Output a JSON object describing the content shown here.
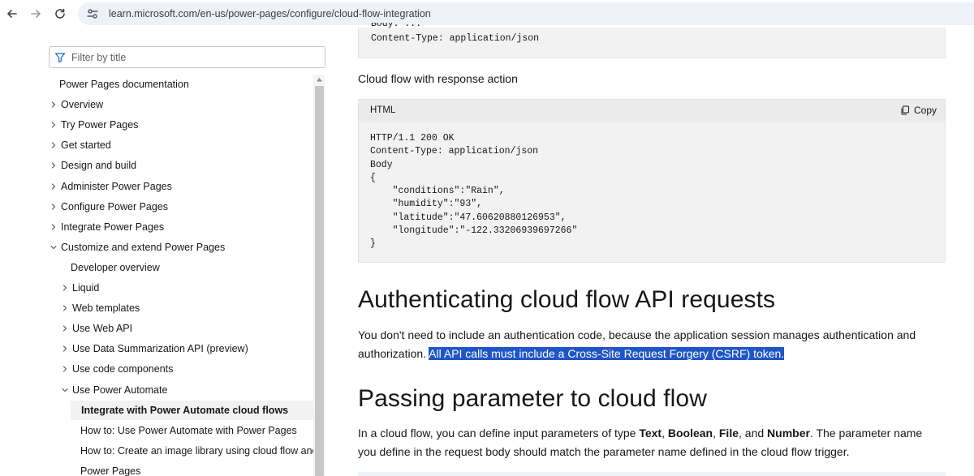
{
  "browser": {
    "url": "learn.microsoft.com/en-us/power-pages/configure/cloud-flow-integration"
  },
  "sidebar": {
    "filter_placeholder": "Filter by title",
    "items": [
      {
        "label": "Power Pages documentation",
        "chevron": "none",
        "level": 0
      },
      {
        "label": "Overview",
        "chevron": "right",
        "level": 0
      },
      {
        "label": "Try Power Pages",
        "chevron": "right",
        "level": 0
      },
      {
        "label": "Get started",
        "chevron": "right",
        "level": 0
      },
      {
        "label": "Design and build",
        "chevron": "right",
        "level": 0
      },
      {
        "label": "Administer Power Pages",
        "chevron": "right",
        "level": 0
      },
      {
        "label": "Configure Power Pages",
        "chevron": "right",
        "level": 0
      },
      {
        "label": "Integrate Power Pages",
        "chevron": "right",
        "level": 0
      },
      {
        "label": "Customize and extend Power Pages",
        "chevron": "down",
        "level": 0
      },
      {
        "label": "Developer overview",
        "chevron": "none",
        "level": 1
      },
      {
        "label": "Liquid",
        "chevron": "right",
        "level": 1
      },
      {
        "label": "Web templates",
        "chevron": "right",
        "level": 1
      },
      {
        "label": "Use Web API",
        "chevron": "right",
        "level": 1
      },
      {
        "label": "Use Data Summarization API (preview)",
        "chevron": "right",
        "level": 1
      },
      {
        "label": "Use code components",
        "chevron": "right",
        "level": 1
      },
      {
        "label": "Use Power Automate",
        "chevron": "down",
        "level": 1
      },
      {
        "label": "Integrate with Power Automate cloud flows",
        "chevron": "none",
        "level": 2,
        "active": true
      },
      {
        "label": "How to: Use Power Automate with Power Pages",
        "chevron": "none",
        "level": 2
      },
      {
        "label": "How to: Create an image library using cloud flow and",
        "chevron": "none",
        "level": 2
      },
      {
        "label": "Power Pages",
        "chevron": "none",
        "level": 2
      }
    ]
  },
  "main": {
    "code_top_line": "Content-Type: application/json",
    "code_top_cut": "Body: ...",
    "response_label": "Cloud flow with response action",
    "code_block": {
      "language": "HTML",
      "copy_label": "Copy",
      "code": "HTTP/1.1 200 OK\nContent-Type: application/json\nBody\n{\n    \"conditions\":\"Rain\",\n    \"humidity\":\"93\",\n    \"latitude\":\"47.60620880126953\",\n    \"longitude\":\"-122.33206939697266\"\n}"
    },
    "heading_auth": "Authenticating cloud flow API requests",
    "auth_text": "You don't need to include an authentication code, because the application session manages authentication and authorization. ",
    "auth_highlight": "All API calls must include a Cross-Site Request Forgery (CSRF) token.",
    "heading_params": "Passing parameter to cloud flow",
    "params_text_1": "In a cloud flow, you can define input parameters of type ",
    "params_type_1": "Text",
    "params_sep_1": ", ",
    "params_type_2": "Boolean",
    "params_sep_2": ", ",
    "params_type_3": "File",
    "params_sep_3": ", and ",
    "params_type_4": "Number",
    "params_text_2": ". The parameter name you define in the request body should match the parameter name defined in the cloud flow trigger."
  }
}
